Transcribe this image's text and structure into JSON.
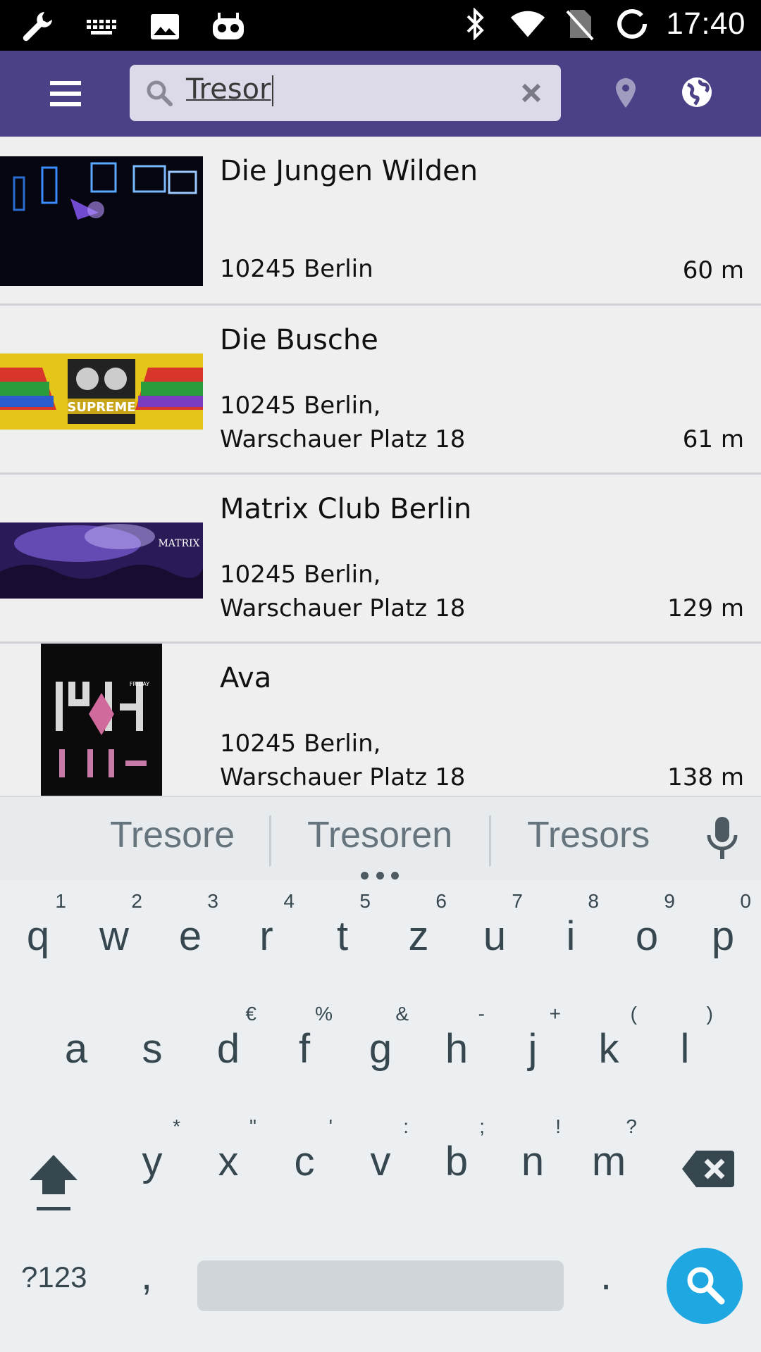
{
  "status_bar": {
    "time": "17:40",
    "left_icons": [
      "wrench-icon",
      "keyboard-icon",
      "image-icon",
      "cyanogen-icon"
    ],
    "right_icons": [
      "bluetooth-icon",
      "wifi-icon",
      "no-sim-icon",
      "sync-ring-icon"
    ]
  },
  "app_bar": {
    "background": "#4b4186",
    "search_value": "Tresor",
    "icons": [
      "menu-icon",
      "search-icon",
      "clear-icon",
      "location-pin-icon",
      "globe-icon"
    ]
  },
  "results": [
    {
      "title": "Die Jungen Wilden",
      "address_line1": "10245 Berlin",
      "address_line2": "",
      "distance": "60 m"
    },
    {
      "title": "Die Busche",
      "address_line1": "10245 Berlin,",
      "address_line2": "Warschauer Platz 18",
      "distance": "61 m"
    },
    {
      "title": "Matrix Club Berlin",
      "address_line1": "10245 Berlin,",
      "address_line2": "Warschauer Platz 18",
      "distance": "129 m"
    },
    {
      "title": "Ava",
      "address_line1": "10245 Berlin,",
      "address_line2": "Warschauer Platz 18",
      "distance": "138 m"
    }
  ],
  "keyboard": {
    "suggestions": [
      "Tresore",
      "Tresoren",
      "Tresors"
    ],
    "row1": [
      {
        "key": "q",
        "hint": "1"
      },
      {
        "key": "w",
        "hint": "2"
      },
      {
        "key": "e",
        "hint": "3"
      },
      {
        "key": "r",
        "hint": "4"
      },
      {
        "key": "t",
        "hint": "5"
      },
      {
        "key": "z",
        "hint": "6"
      },
      {
        "key": "u",
        "hint": "7"
      },
      {
        "key": "i",
        "hint": "8"
      },
      {
        "key": "o",
        "hint": "9"
      },
      {
        "key": "p",
        "hint": "0"
      }
    ],
    "row2": [
      {
        "key": "a",
        "hint": ""
      },
      {
        "key": "s",
        "hint": ""
      },
      {
        "key": "d",
        "hint": "€"
      },
      {
        "key": "f",
        "hint": "%"
      },
      {
        "key": "g",
        "hint": "&"
      },
      {
        "key": "h",
        "hint": "-"
      },
      {
        "key": "j",
        "hint": "+"
      },
      {
        "key": "k",
        "hint": "("
      },
      {
        "key": "l",
        "hint": ")"
      }
    ],
    "row3": [
      {
        "key": "y",
        "hint": "*"
      },
      {
        "key": "x",
        "hint": "\""
      },
      {
        "key": "c",
        "hint": "'"
      },
      {
        "key": "v",
        "hint": ":"
      },
      {
        "key": "b",
        "hint": ";"
      },
      {
        "key": "n",
        "hint": "!"
      },
      {
        "key": "m",
        "hint": "?"
      }
    ],
    "symbols_label": "?123",
    "comma": ",",
    "period": ".",
    "accent_color": "#1ea7e0"
  }
}
